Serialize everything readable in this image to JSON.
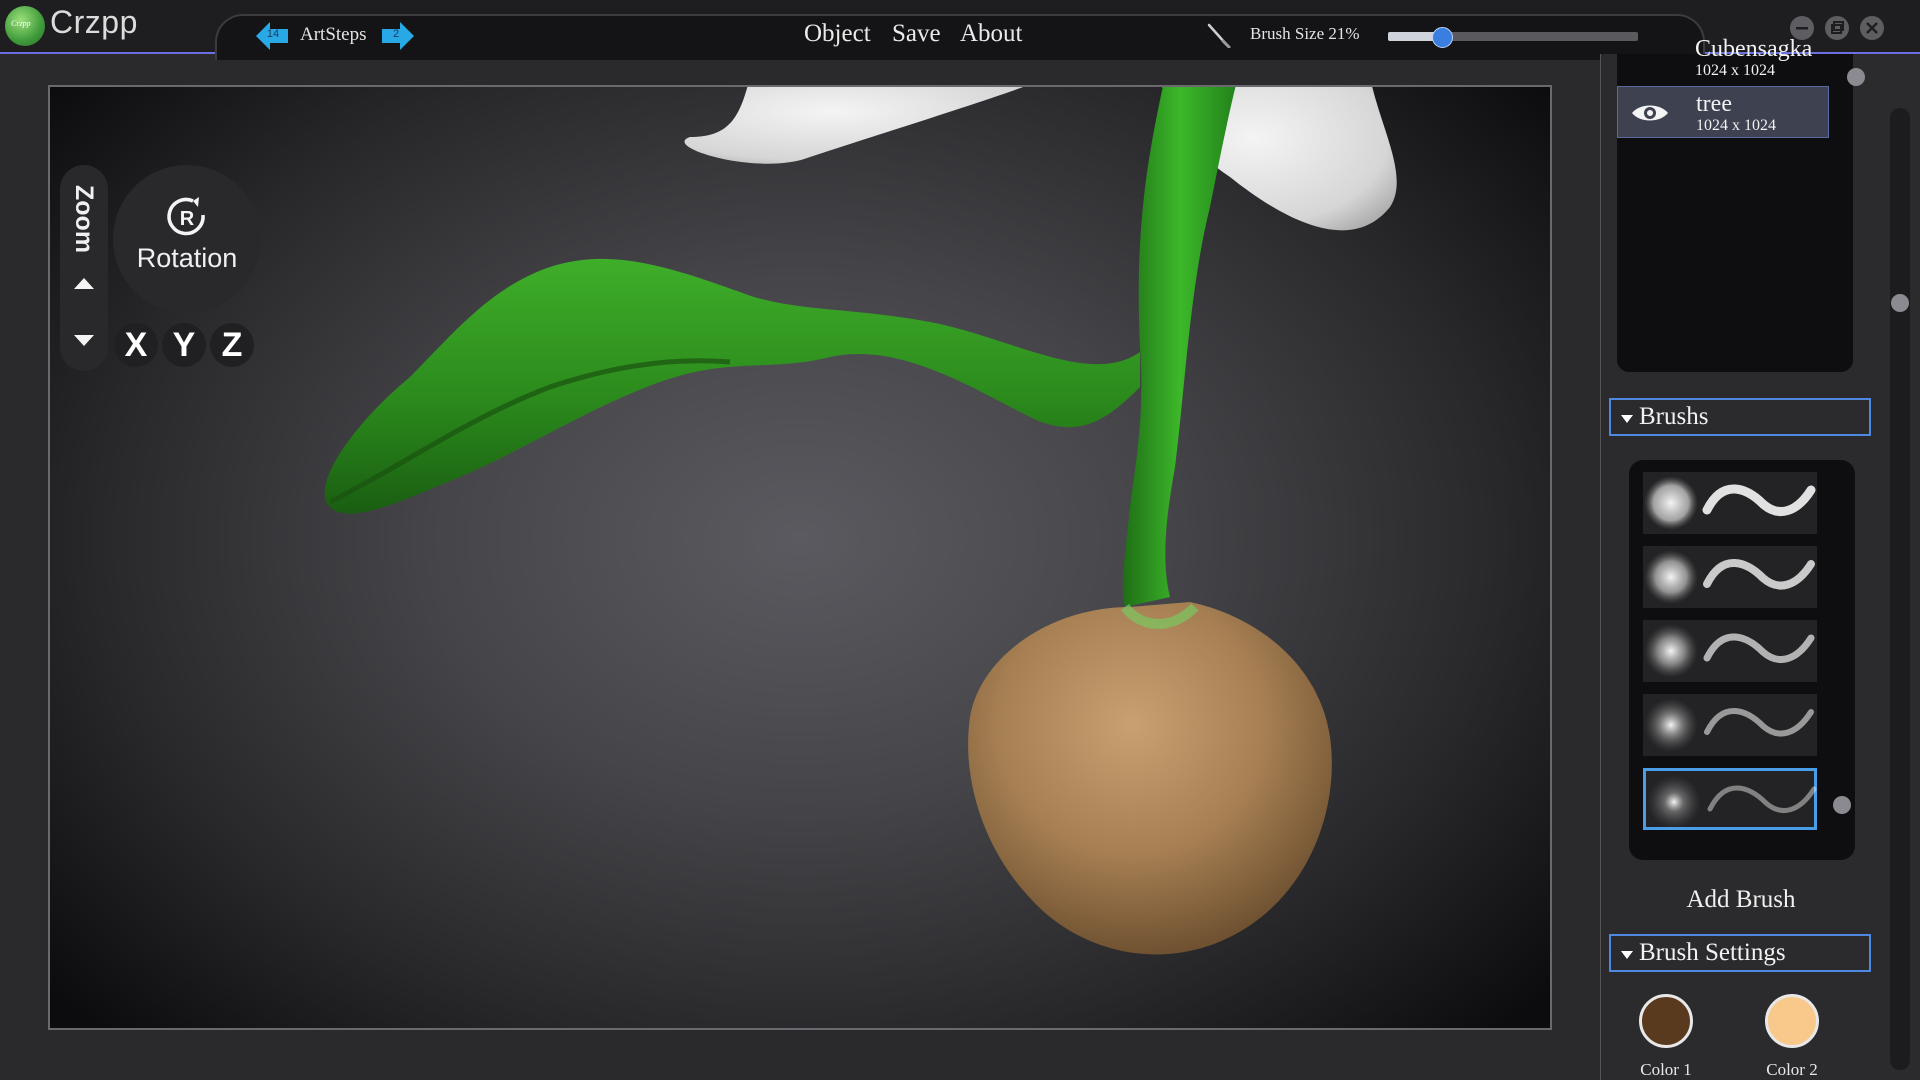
{
  "app": {
    "name": "Crzpp",
    "logo_text": "Crzpp"
  },
  "nav": {
    "label": "ArtSteps",
    "back_count": "14",
    "forward_count": "2"
  },
  "menu": {
    "object": "Object",
    "save": "Save",
    "about": "About"
  },
  "brush_size": {
    "label": "Brush Size 21%",
    "value_percent": 21
  },
  "viewport": {
    "zoom_label": "Zoom",
    "rotation_label": "Rotation",
    "rotation_icon_letter": "R",
    "axes": [
      "X",
      "Y",
      "Z"
    ]
  },
  "layers": [
    {
      "name": "Cubensagka",
      "size": "1024 x 1024",
      "selected": false
    },
    {
      "name": "tree",
      "size": "1024 x 1024",
      "selected": true
    }
  ],
  "brushes_section": {
    "label": "Brushs",
    "add_label": "Add Brush",
    "selected_index": 4,
    "count": 5
  },
  "brush_settings": {
    "label": "Brush Settings",
    "color1": {
      "label": "Color 1",
      "value": "#5a3a1e"
    },
    "color2": {
      "label": "Color 2",
      "value": "#f8c98a"
    }
  },
  "colors": {
    "accent": "#4f88e0",
    "slider": "#3a7fe0",
    "nav_arrow": "#29a8e6"
  }
}
